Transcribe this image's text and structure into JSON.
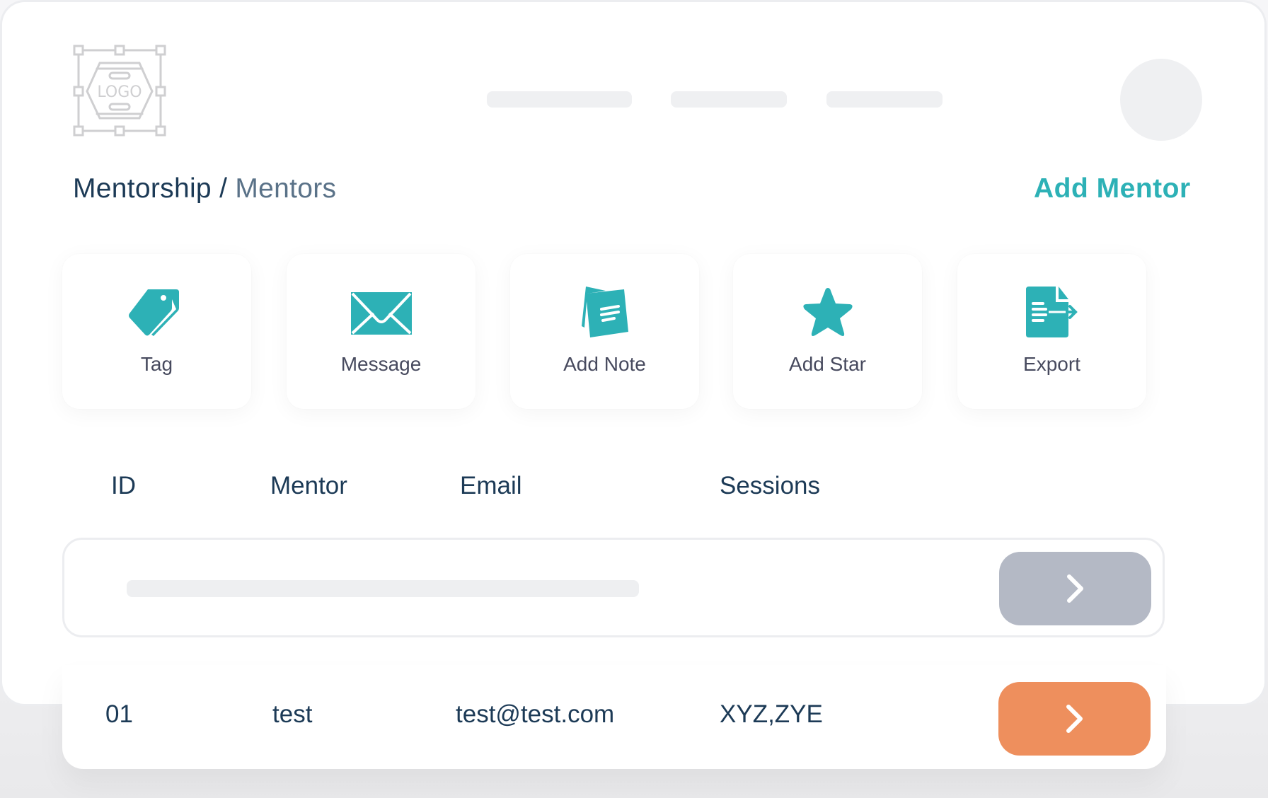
{
  "header": {
    "logo_text": "LOGO",
    "nav_placeholders": 3,
    "avatar": "user-avatar-placeholder"
  },
  "breadcrumb": {
    "root": "Mentorship",
    "separator": "/",
    "current": "Mentors"
  },
  "actions": {
    "add_mentor_label": "Add Mentor",
    "tiles": [
      {
        "label": "Tag",
        "icon": "tag-icon"
      },
      {
        "label": "Message",
        "icon": "envelope-icon"
      },
      {
        "label": "Add Note",
        "icon": "note-icon"
      },
      {
        "label": "Add Star",
        "icon": "star-icon"
      },
      {
        "label": "Export",
        "icon": "export-file-icon"
      }
    ]
  },
  "table": {
    "columns": [
      "ID",
      "Mentor",
      "Email",
      "Sessions"
    ],
    "rows": [
      {
        "placeholder": true
      },
      {
        "id": "01",
        "mentor": "test",
        "email": "test@test.com",
        "sessions": "XYZ,ZYE"
      }
    ]
  },
  "colors": {
    "accent": "#2db1b6",
    "primary_text": "#1c3a56",
    "secondary_text": "#5a7288",
    "row_button_inactive": "#b4b9c5",
    "row_button_active": "#ee8f5d"
  }
}
